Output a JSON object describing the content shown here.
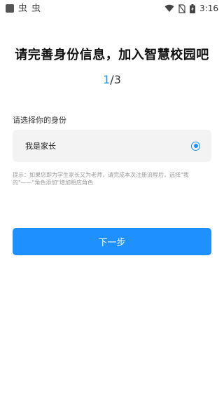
{
  "status_bar": {
    "left_glyphs": [
      "虫",
      "虫"
    ],
    "time": "3:16"
  },
  "page": {
    "title": "请完善身份信息，加入智慧校园吧",
    "step_current": "1",
    "step_total": "/3"
  },
  "role_section": {
    "label": "请选择你的身份",
    "selected_option": "我是家长",
    "hint": "提示：如果您即为学生家长又为老师，请完成本次注册流程后，选择\"我的\"——\"角色添加\"增加相应角色"
  },
  "actions": {
    "next_label": "下一步"
  },
  "colors": {
    "accent": "#1e90ff",
    "hint": "#9a9a9a",
    "option_bg": "#f3f3f3"
  },
  "icons": {
    "status_left": "app-notification-icon",
    "wifi": "wifi-icon",
    "sim": "no-sim-icon",
    "battery": "battery-charging-icon",
    "radio": "radio-selected-icon"
  }
}
